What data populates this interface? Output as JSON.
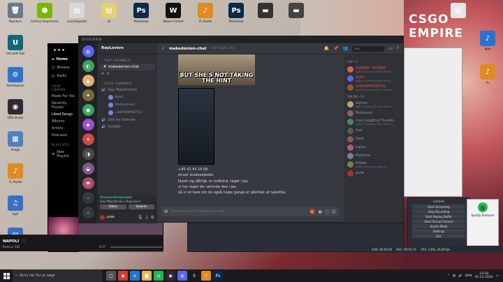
{
  "desktop": {
    "icons_left": [
      {
        "label": "Papirkurv",
        "glyph": "🗑",
        "color": "#6a7a8a"
      },
      {
        "label": "Uninstall Tool",
        "glyph": "U",
        "color": "#0f6a75"
      },
      {
        "label": "Kontrolpanel",
        "glyph": "⚙",
        "color": "#3074c8"
      },
      {
        "label": "OBS Studio",
        "glyph": "◉",
        "color": "#302a36"
      },
      {
        "label": "Image",
        "glyph": "▦",
        "color": "#5080c0"
      },
      {
        "label": "FL Studio",
        "glyph": "♪",
        "color": "#e08a20"
      },
      {
        "label": "mp3",
        "glyph": "♫",
        "color": "#3a6fc9"
      },
      {
        "label": "Dokument",
        "glyph": "▤",
        "color": "#3a6fc9"
      }
    ],
    "icons_top": [
      {
        "label": "GeForce Experience",
        "glyph": "⬢",
        "color": "#76b900"
      },
      {
        "label": "voicelingo.bat",
        "glyph": "▤",
        "color": "#d8d8d8"
      },
      {
        "label": "lol",
        "glyph": "▤",
        "color": "#e6d070"
      },
      {
        "label": "Photoshop",
        "glyph": "Ps",
        "color": "#0b2a4a"
      },
      {
        "label": "Waves Central",
        "glyph": "W",
        "color": "#111111"
      },
      {
        "label": "FL Studio",
        "glyph": "♪",
        "color": "#e08a20"
      },
      {
        "label": "Photoshop",
        "glyph": "Ps",
        "color": "#0b2a4a"
      },
      {
        "label": "",
        "glyph": "▬",
        "color": "#333333"
      },
      {
        "label": "",
        "glyph": "▬",
        "color": "#444444"
      }
    ],
    "icons_right": [
      {
        "label": "",
        "glyph": "▤",
        "color": "#e5e5e5"
      },
      {
        "label": "WAV",
        "glyph": "♪",
        "color": "#2a72d0"
      },
      {
        "label": "FL",
        "glyph": "♪",
        "color": "#e08a20"
      }
    ],
    "wallpaper_text": "CSGO EMPIRE"
  },
  "spotify": {
    "nav": [
      {
        "label": "Home",
        "icon": "⌂",
        "active": true
      },
      {
        "label": "Browse",
        "icon": "◫",
        "active": false
      },
      {
        "label": "Radio",
        "icon": "◎",
        "active": false
      }
    ],
    "library_header": "YOUR LIBRARY",
    "library": [
      {
        "label": "Made For You",
        "active": false
      },
      {
        "label": "Recently Played",
        "active": false
      },
      {
        "label": "Liked Songs",
        "active": true
      },
      {
        "label": "Albums",
        "active": false
      },
      {
        "label": "Artists",
        "active": false
      },
      {
        "label": "Podcasts",
        "active": false
      }
    ],
    "playlists_header": "PLAYLISTS",
    "new_playlist": "New Playlist",
    "now_playing_title": "NAPOLI",
    "now_playing_artist": "Branco, Gilli",
    "time_elapsed": "0:57"
  },
  "discord": {
    "app_title": "DISCORD",
    "server_name": "RayLovers",
    "categories": {
      "text": "TEXT CHANNELS",
      "voice": "VOICE CHANNELS"
    },
    "text_channels": [
      {
        "name": "makedonien-chat",
        "active": true
      },
      {
        "name": "xt",
        "active": false
      }
    ],
    "voice_channels": [
      {
        "name": "Gay MakeDonien",
        "users": [
          "Kyrel",
          "Meihemmed",
          "xXBRAMMODTXx"
        ]
      },
      {
        "name": "Ikke for homoer",
        "users": []
      },
      {
        "name": "SOUND",
        "users": []
      }
    ],
    "voice_panel": {
      "status": "Stemmeforbundet",
      "sub": "Gay MakeDonien / RayLovers",
      "video": "Video",
      "screen": "Skærm"
    },
    "user": {
      "name": "polle",
      "tag": "#0000"
    },
    "header": {
      "channel": "makedonien-chat",
      "topic": "mit Angim. Nej",
      "search": "Søg"
    },
    "meme_text": "BUT SHE'S NOT TAKING THE HINT",
    "messages": [
      "+45 42 43 19 09",
      "struer studevejleder",
      "klarer sig dårligt, er ordblind, taget i jau",
      "vi har taget din veninde dea i jau",
      "så vi vil hare om du også nogle gange er påvirket af nakotika"
    ],
    "input_placeholder": "Send besked i #makedonien-chat",
    "members_sections": [
      {
        "title": "GAY—3",
        "members": [
          {
            "name": "GINGER—POWER",
            "sub": "Spiller Counter-Strike: Global...",
            "online": true,
            "color": "#e35a4a"
          },
          {
            "name": "Kyrel",
            "sub": "Spiller Counter-Strike: Global...",
            "online": true,
            "color": "#5865f2"
          },
          {
            "name": "XXBRAMMODTXx",
            "sub": "Spiller Counter-Strike: Global...",
            "online": true,
            "color": "#a0522d"
          }
        ]
      },
      {
        "title": "ONLINE—11",
        "members": [
          {
            "name": "Ashton",
            "sub": "Spiller Counter-Strike: Global...",
            "online": false,
            "color": "#c0a070"
          },
          {
            "name": "Bobmand",
            "sub": "",
            "online": false,
            "color": "#7a6a5a"
          },
          {
            "name": "Cock Juggling Thunde...",
            "sub": "Spiller Counter-Strike: Global...",
            "online": false,
            "color": "#4a8a6a"
          },
          {
            "name": "fnat",
            "sub": "",
            "online": false,
            "color": "#5a5a5a"
          },
          {
            "name": "Hald",
            "sub": "",
            "online": false,
            "color": "#8a5a4a"
          },
          {
            "name": "lupiya",
            "sub": "",
            "online": false,
            "color": "#b05a7a"
          },
          {
            "name": "Matthew",
            "sub": "",
            "online": false,
            "color": "#7a7aaa"
          },
          {
            "name": "Mikkel",
            "sub": "Spiller League of Legends",
            "online": false,
            "color": "#6a8a4a"
          },
          {
            "name": "polle",
            "sub": "",
            "online": false,
            "color": "#aa3030"
          }
        ]
      }
    ]
  },
  "obs": {
    "controls_title": "Controls",
    "buttons": [
      "Start Streaming",
      "Stop Recording",
      "Start Replay Buffer",
      "Start Virtual Camera",
      "Studio Mode",
      "Settings",
      "Exit"
    ],
    "status": [
      "LIVE: 00:00:00",
      "REC: 00:01:15",
      "CPU: 2.8%, 30.00 fps"
    ],
    "mini_label": "Spotify Premium"
  },
  "taskbar": {
    "search_placeholder": "Skriv her for at søge",
    "apps": [
      {
        "glyph": "▢",
        "color": "#555555"
      },
      {
        "glyph": "◉",
        "color": "#d03b2f"
      },
      {
        "glyph": "e",
        "color": "#1e78d4"
      },
      {
        "glyph": "▇",
        "color": "#e8b64a"
      },
      {
        "glyph": "◎",
        "color": "#1db954"
      },
      {
        "glyph": "◉",
        "color": "#302a36"
      },
      {
        "glyph": "◍",
        "color": "#5865f2"
      },
      {
        "glyph": "S",
        "color": "#1a1a1a"
      },
      {
        "glyph": "♪",
        "color": "#e08a20"
      },
      {
        "glyph": "Ps",
        "color": "#0b2a4a"
      }
    ],
    "lang": "DAN",
    "time": "23:18",
    "date": "05-12-2020"
  }
}
